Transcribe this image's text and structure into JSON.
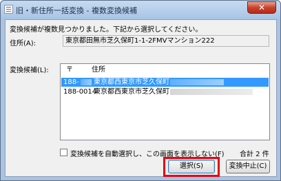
{
  "window": {
    "title": "旧・新住所一括変換 - 複数変換候補",
    "close_symbol": "✕"
  },
  "message": "変換候補が複数見つかりました。下記から選択してください。",
  "address": {
    "label": "住所(A):",
    "value": "東京都田無市芝久保町1-1-2FMVマンション222"
  },
  "candidates": {
    "label": "変換候補(L):",
    "columns": [
      "〒",
      "住所"
    ],
    "rows": [
      {
        "zip": "188-",
        "address": "東京都西東京市芝久保町",
        "selected": true
      },
      {
        "zip": "188-0014",
        "address": "東京都西東京市芝久保町",
        "selected": false
      }
    ]
  },
  "auto_select": {
    "label": "変換候補を自動選択し、この画面を表示しない(F)",
    "checked": false
  },
  "total": "合計 2 件",
  "buttons": {
    "select": "選択(S)",
    "cancel": "変換中止(C)"
  },
  "colors": {
    "selection": "#3399ff",
    "highlight_frame": "#e60012"
  }
}
